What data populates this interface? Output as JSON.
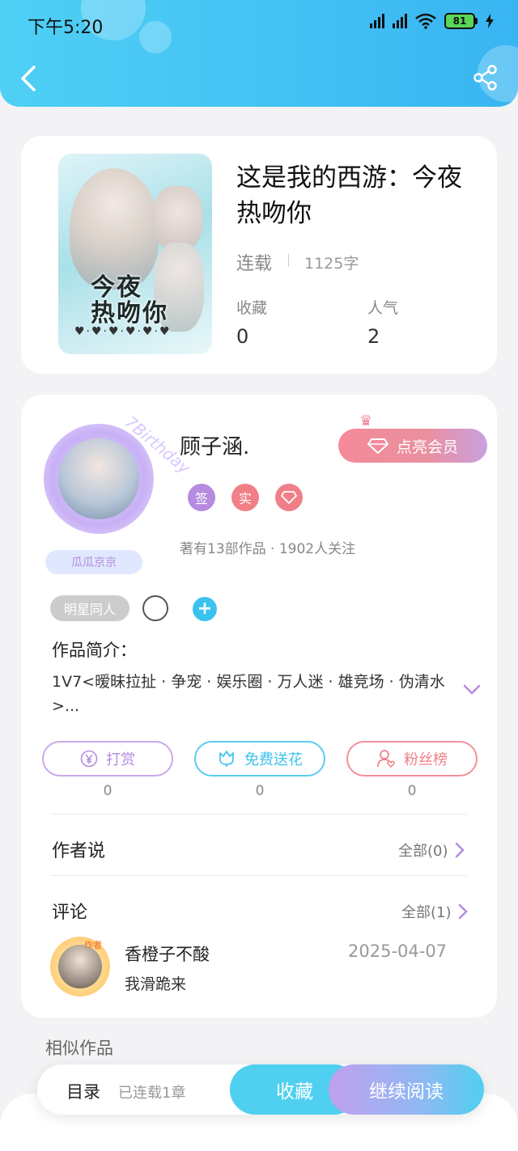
{
  "status_bar": {
    "time": "下午5:20",
    "battery": "81"
  },
  "book": {
    "title": "这是我的西游：今夜热吻你",
    "cover_text": "今夜\n热吻你",
    "status": "连载",
    "word_count": "1125字",
    "stats": [
      {
        "label": "收藏",
        "value": "0"
      },
      {
        "label": "人气",
        "value": "2"
      }
    ]
  },
  "author": {
    "name": "顾子涵.",
    "vip_label": "点亮会员",
    "frame_text": "7Birthday",
    "badge_tag": "瓜瓜京京",
    "badges": [
      {
        "text": "签",
        "color": "#b68be0"
      },
      {
        "text": "实",
        "color": "#f07f88"
      },
      {
        "text": "◇",
        "color": "#f07f88"
      }
    ],
    "stats_text": "著有13部作品 · 1902人关注"
  },
  "tags": {
    "first": "明星同人",
    "plus": "+"
  },
  "intro": {
    "label": "作品简介：",
    "text": "1V7<暧昧拉扯 · 争宠 · 娱乐圈 · 万人迷 · 雄竞场 · 伪清水>..."
  },
  "actions": [
    {
      "label": "打赏",
      "count": "0",
      "icon": "yen-icon",
      "color": "#b68be0"
    },
    {
      "label": "免费送花",
      "count": "0",
      "icon": "flower-icon",
      "color": "#3cc2f0"
    },
    {
      "label": "粉丝榜",
      "count": "0",
      "icon": "fan-icon",
      "color": "#f07f88"
    }
  ],
  "author_says": {
    "title": "作者说",
    "more": "全部(0)"
  },
  "comments": {
    "title": "评论",
    "more": "全部(1)",
    "items": [
      {
        "name": "香橙子不酸",
        "date": "2025-04-07",
        "text": "我滑跪来",
        "avatar_tag": "作者"
      }
    ]
  },
  "similar": {
    "title": "相似作品"
  },
  "bottom_bar": {
    "toc": "目录",
    "toc_count": "已连载1章",
    "favorite": "收藏",
    "continue": "继续阅读"
  },
  "colors": {
    "header": "#39b5f2",
    "accent": "#3cc2f0",
    "purple": "#b68be0",
    "pink": "#f07f88"
  }
}
